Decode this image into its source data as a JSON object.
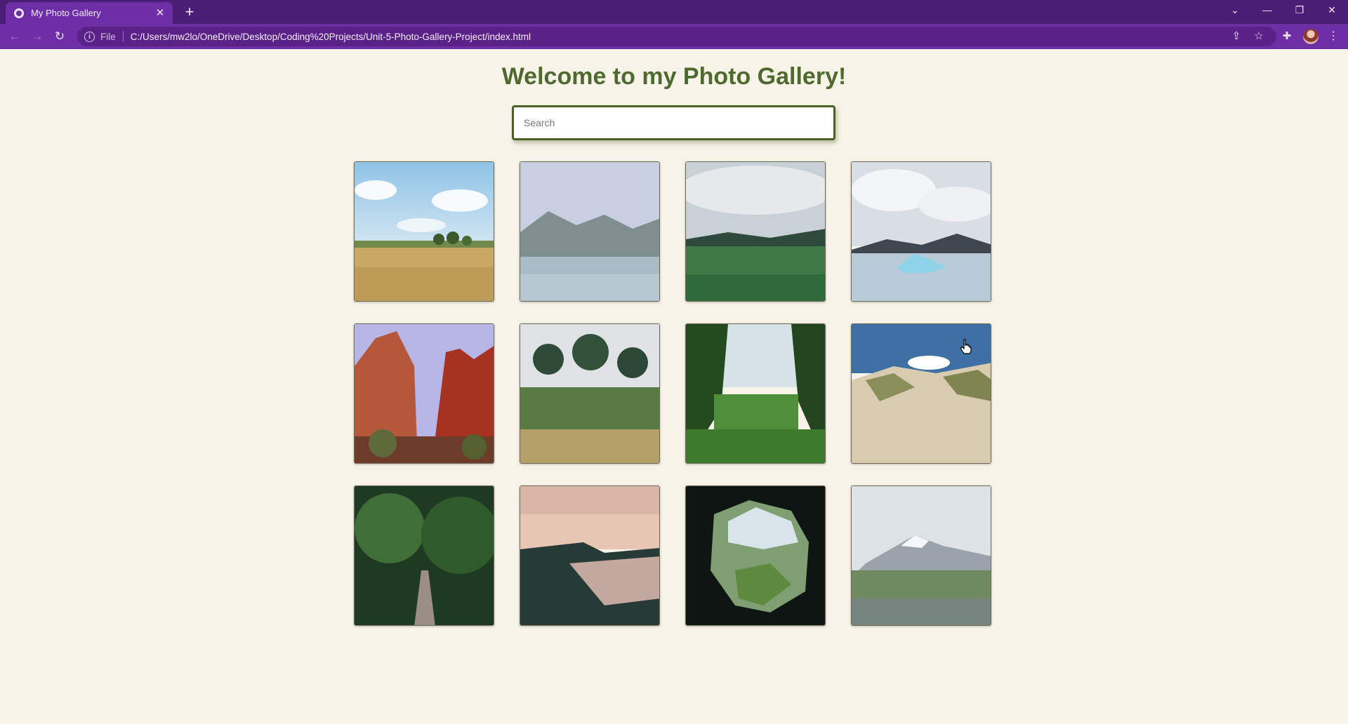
{
  "browser": {
    "tab_title": "My Photo Gallery",
    "tab_close_glyph": "✕",
    "new_tab_glyph": "+",
    "address_scheme": "File",
    "address_url": "C:/Users/mw2lo/OneDrive/Desktop/Coding%20Projects/Unit-5-Photo-Gallery-Project/index.html",
    "window_controls": {
      "tab_list": "⌄",
      "minimize": "—",
      "restore": "❐",
      "close": "✕"
    },
    "nav_icons": {
      "back": "←",
      "forward": "→",
      "reload": "↻",
      "share": "⇪",
      "bookmark": "☆",
      "extensions": "✚",
      "menu": "⋮",
      "info": "i"
    },
    "colors": {
      "tabbar": "#4a1e74",
      "toolbar": "#6e2fa6"
    }
  },
  "page": {
    "title": "Welcome to my Photo Gallery!",
    "search_placeholder": "Search",
    "background": "#f8f3e8",
    "title_color": "#4f6a2e"
  },
  "gallery": [
    {
      "name": "photo-hayfield"
    },
    {
      "name": "photo-lake-mountains"
    },
    {
      "name": "photo-green-meadow"
    },
    {
      "name": "photo-glacier-lagoon"
    },
    {
      "name": "photo-red-canyon"
    },
    {
      "name": "photo-garden-trees"
    },
    {
      "name": "photo-green-valley"
    },
    {
      "name": "photo-sand-dunes"
    },
    {
      "name": "photo-forest-path"
    },
    {
      "name": "photo-coastal-sunset"
    },
    {
      "name": "photo-cave-view"
    },
    {
      "name": "photo-snowy-mountain-field"
    }
  ]
}
